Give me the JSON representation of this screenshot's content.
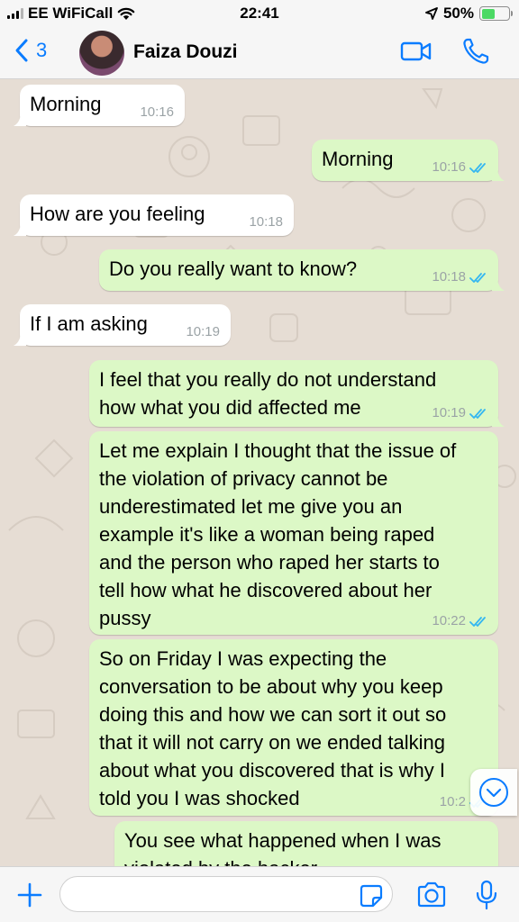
{
  "status_bar": {
    "carrier": "EE WiFiCall",
    "time": "22:41",
    "battery": "50%",
    "battery_level": 0.5
  },
  "header": {
    "back_count": "3",
    "contact_name": "Faiza Douzi",
    "icons": [
      "chevron-left-icon",
      "video-call-icon",
      "phone-icon"
    ]
  },
  "messages": [
    {
      "dir": "in",
      "lines": [
        "Morning"
      ],
      "time": "10:16"
    },
    {
      "dir": "out",
      "lines": [
        "Morning"
      ],
      "time": "10:16",
      "read": true
    },
    {
      "dir": "in",
      "lines": [
        "How are you feeling"
      ],
      "time": "10:18"
    },
    {
      "dir": "out",
      "lines": [
        "Do you really want to know?"
      ],
      "time": "10:18",
      "read": true
    },
    {
      "dir": "in",
      "lines": [
        "If I am asking"
      ],
      "time": "10:19"
    },
    {
      "dir": "out",
      "lines": [
        "I feel that you really do not understand",
        "how what you did affected me"
      ],
      "time": "10:19",
      "read": true
    },
    {
      "dir": "out",
      "lines": [
        "Let me explain I thought that the issue of",
        "the violation of privacy cannot be",
        "underestimated let me give you an",
        "example it's like a woman being raped",
        "and the person who raped her starts to",
        "tell how what he discovered about her",
        "pussy"
      ],
      "time": "10:22",
      "read": true
    },
    {
      "dir": "out",
      "lines": [
        "So on Friday I was expecting the",
        "conversation to be about why you keep",
        "doing this and how we can sort it out so",
        "that it will not carry on we ended talking",
        "about what you discovered that is why I",
        "told you I was shocked"
      ],
      "time": "10:2",
      "read": true
    },
    {
      "dir": "out",
      "lines": [
        "You see what happened when I was",
        "violated by the hacker"
      ],
      "time": "",
      "read": false
    }
  ],
  "input": {
    "value": "",
    "placeholder": ""
  },
  "colors": {
    "accent": "#0a7cff",
    "incoming_bubble": "#ffffff",
    "outgoing_bubble": "#dcf8c6",
    "read_ticks": "#34b7f1",
    "wallpaper": "#e6ddd4",
    "battery": "#4cd964"
  }
}
